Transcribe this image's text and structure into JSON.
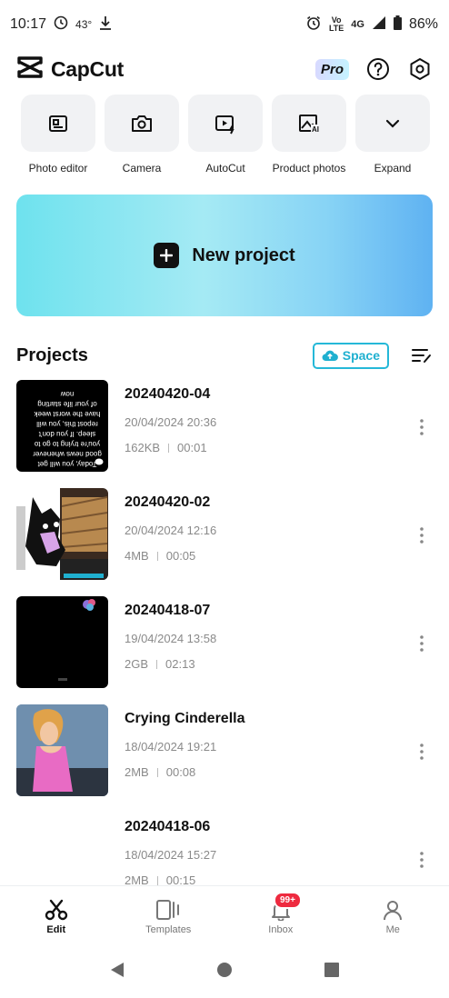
{
  "status_bar": {
    "time": "10:17",
    "temperature": "43°",
    "network_top": "Vo",
    "network_mid": "LTE",
    "network_type": "4G",
    "battery": "86%"
  },
  "header": {
    "app_name": "CapCut",
    "pro_label": "Pro"
  },
  "tools": [
    {
      "label": "Photo editor",
      "icon": "photo-editor-icon"
    },
    {
      "label": "Camera",
      "icon": "camera-icon"
    },
    {
      "label": "AutoCut",
      "icon": "autocut-icon"
    },
    {
      "label": "Product photos",
      "icon": "product-photos-icon"
    },
    {
      "label": "Expand",
      "icon": "chevron-down-icon"
    }
  ],
  "new_project": {
    "label": "New project"
  },
  "projects": {
    "title": "Projects",
    "space_label": "Space",
    "items": [
      {
        "name": "20240420-04",
        "date": "20/04/2024 20:36",
        "size": "162KB",
        "duration": "00:01",
        "thumb_text": "Today, you will get good news whenever you're trying to go to sleep. If you don't repost this, you will have the worst week of your life starting now"
      },
      {
        "name": "20240420-02",
        "date": "20/04/2024 12:16",
        "size": "4MB",
        "duration": "00:05"
      },
      {
        "name": "20240418-07",
        "date": "19/04/2024 13:58",
        "size": "2GB",
        "duration": "02:13"
      },
      {
        "name": "Crying Cinderella",
        "date": "18/04/2024 19:21",
        "size": "2MB",
        "duration": "00:08"
      },
      {
        "name": "20240418-06",
        "date": "18/04/2024 15:27",
        "size": "2MB",
        "duration": "00:15"
      }
    ]
  },
  "bottom_nav": {
    "items": [
      {
        "label": "Edit",
        "icon": "scissors-icon",
        "active": true
      },
      {
        "label": "Templates",
        "icon": "templates-icon",
        "active": false
      },
      {
        "label": "Inbox",
        "icon": "bell-icon",
        "active": false,
        "badge": "99+"
      },
      {
        "label": "Me",
        "icon": "person-icon",
        "active": false
      }
    ]
  },
  "colors": {
    "accent": "#25b8d8",
    "badge": "#ee2a3f",
    "gradient_start": "#6ee2ee",
    "gradient_end": "#5fb2f2"
  }
}
